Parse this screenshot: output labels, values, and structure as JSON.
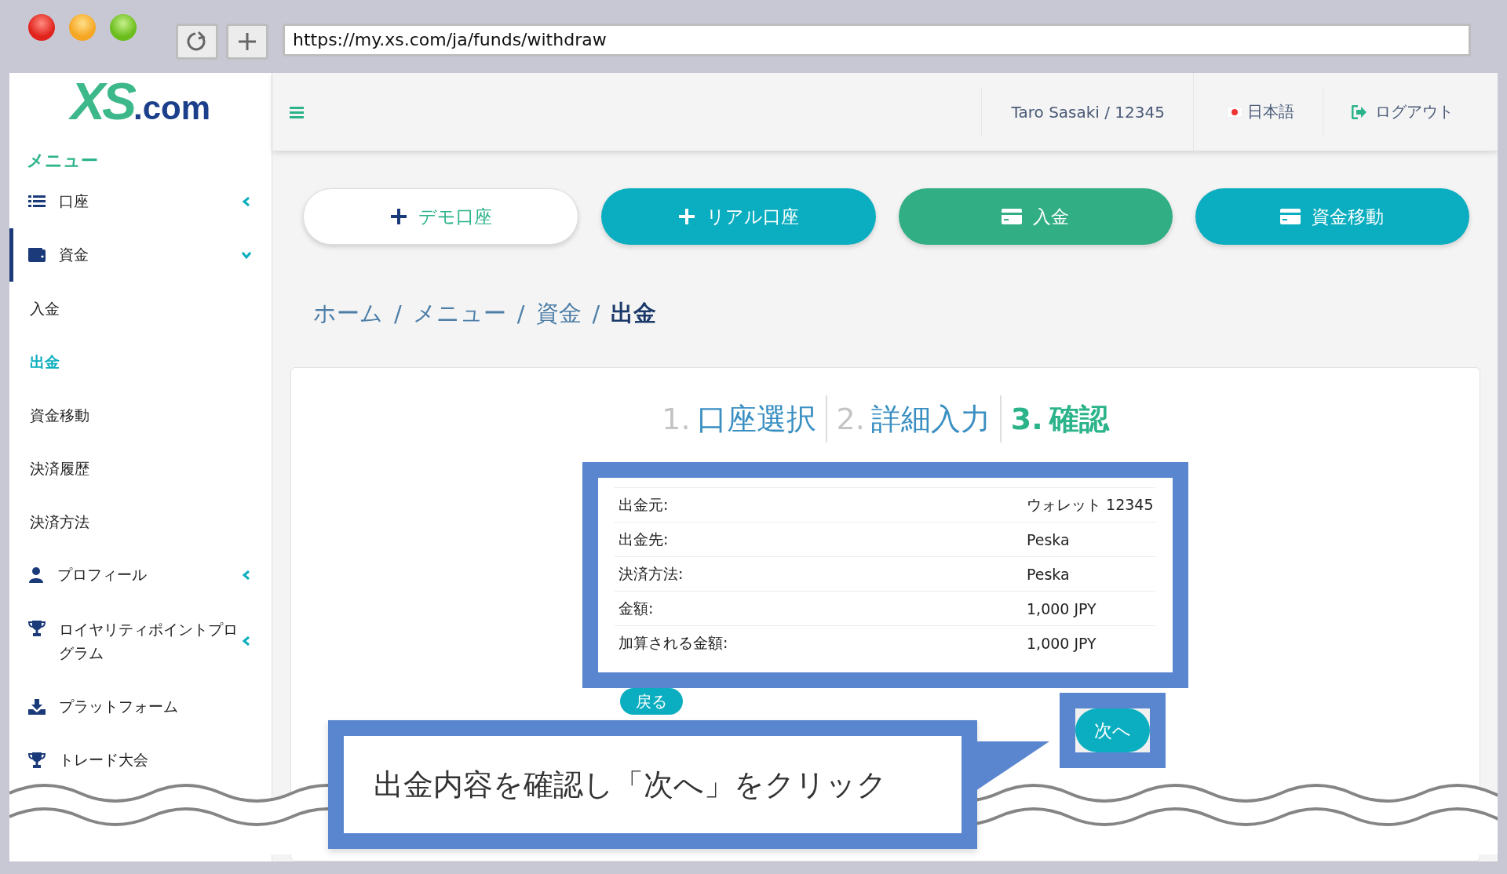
{
  "browser": {
    "url": "https://my.xs.com/ja/funds/withdraw"
  },
  "sidebar": {
    "logo": {
      "mark": "XS",
      "suffix": ".com"
    },
    "heading": "メニュー",
    "items": [
      {
        "label": "口座",
        "kind": "group",
        "expanded": false,
        "selected": false
      },
      {
        "label": "資金",
        "kind": "group",
        "expanded": true,
        "selected": true,
        "children": [
          {
            "label": "入金",
            "selected": false
          },
          {
            "label": "出金",
            "selected": true
          },
          {
            "label": "資金移動",
            "selected": false
          },
          {
            "label": "決済履歴",
            "selected": false
          },
          {
            "label": "決済方法",
            "selected": false
          }
        ]
      },
      {
        "label": "プロフィール",
        "kind": "group",
        "expanded": false,
        "selected": false
      },
      {
        "label": "ロイヤリティポイントプログラム",
        "kind": "group",
        "expanded": false,
        "selected": false
      },
      {
        "label": "プラットフォーム",
        "kind": "link",
        "selected": false
      },
      {
        "label": "トレード大会",
        "kind": "link",
        "selected": false
      }
    ]
  },
  "header": {
    "user": "Taro Sasaki / 12345",
    "language": "日本語",
    "logout": "ログアウト"
  },
  "actions": [
    {
      "label": "デモ口座",
      "kind": "outline"
    },
    {
      "label": "リアル口座",
      "kind": "teal"
    },
    {
      "label": "入金",
      "kind": "green"
    },
    {
      "label": "資金移動",
      "kind": "teal"
    }
  ],
  "breadcrumb": [
    {
      "label": "ホーム",
      "selected": false
    },
    {
      "separator": "/",
      "label": "メニュー",
      "selected": false
    },
    {
      "separator": "/",
      "label": "資金",
      "selected": false
    },
    {
      "separator": "/",
      "label": "出金",
      "selected": true
    }
  ],
  "steps": [
    {
      "number": "1.",
      "label": "口座選択",
      "selected": false
    },
    {
      "number": "2.",
      "label": "詳細入力",
      "selected": false
    },
    {
      "number": "3.",
      "label": "確認",
      "selected": true
    }
  ],
  "summary": [
    {
      "label": "出金元:",
      "value": "ウォレット 12345"
    },
    {
      "label": "出金先:",
      "value": "Peska"
    },
    {
      "label": "決済方法:",
      "value": "Peska"
    },
    {
      "label": "金額:",
      "value": "1,000 JPY"
    },
    {
      "label": "加算される金額:",
      "value": "1,000 JPY"
    }
  ],
  "back_button": "戻る",
  "next_button": "次へ",
  "callout": "出金内容を確認し「次へ」をクリック"
}
